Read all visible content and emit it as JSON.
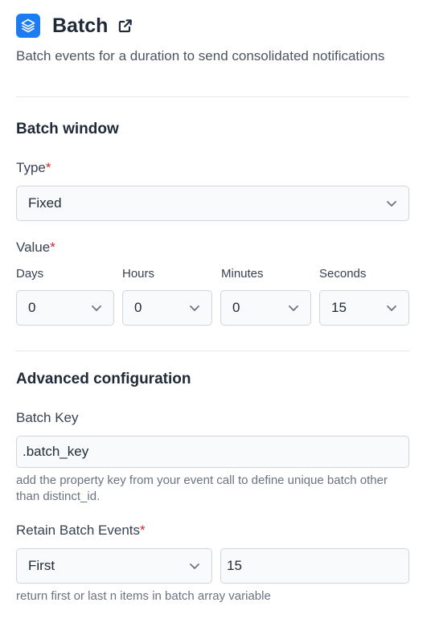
{
  "header": {
    "title": "Batch",
    "description": "Batch events for a duration to send consolidated notifications",
    "icon": "layers-icon",
    "link_icon": "external-link-icon",
    "accent": "#1d7cf2"
  },
  "batch_window": {
    "section_title": "Batch window",
    "type_label": "Type",
    "type_value": "Fixed",
    "value_label": "Value",
    "required_mark": "*",
    "units": [
      {
        "label": "Days",
        "value": "0"
      },
      {
        "label": "Hours",
        "value": "0"
      },
      {
        "label": "Minutes",
        "value": "0"
      },
      {
        "label": "Seconds",
        "value": "15"
      }
    ]
  },
  "advanced": {
    "section_title": "Advanced configuration",
    "batch_key_label": "Batch Key",
    "batch_key_value": ".batch_key",
    "batch_key_help": "add the property key from your event call to define unique batch other than distinct_id.",
    "retain_label": "Retain Batch Events",
    "retain_mode": "First",
    "retain_count": "15",
    "retain_help": "return first or last n items in batch array variable"
  },
  "colors": {
    "required": "#dc2626",
    "field_border": "#d1d5db",
    "field_bg": "#f9fafb"
  }
}
